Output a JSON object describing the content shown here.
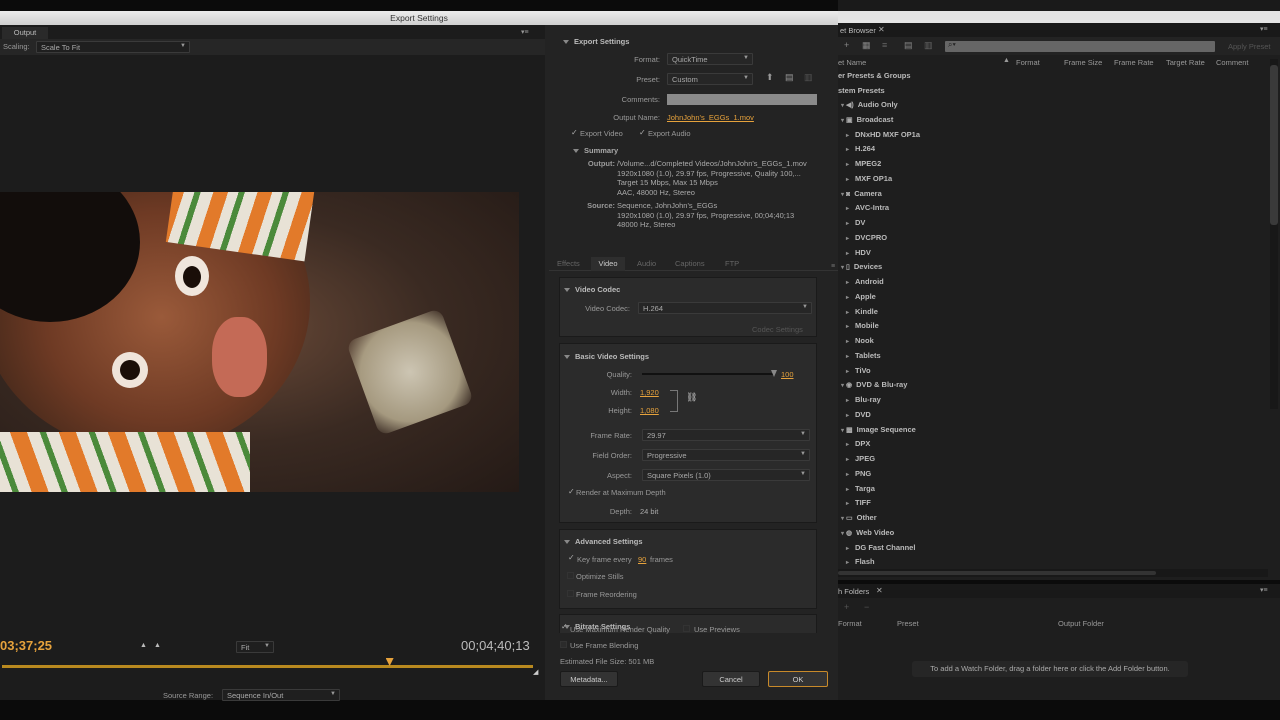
{
  "window": {
    "title": "Export Settings"
  },
  "left": {
    "tab": "Output",
    "scaling_label": "Scaling:",
    "scaling_value": "Scale To Fit",
    "timecode_in": "03;37;25",
    "timecode_out": "00;04;40;13",
    "fit_value": "Fit",
    "source_range_label": "Source Range:",
    "source_range_value": "Sequence In/Out",
    "playhead": 0.73
  },
  "export": {
    "section": "Export Settings",
    "format_label": "Format:",
    "format_value": "QuickTime",
    "preset_label": "Preset:",
    "preset_value": "Custom",
    "comments_label": "Comments:",
    "output_name_label": "Output Name:",
    "output_name": "JohnJohn's_EGGs_1.mov",
    "export_video": "Export Video",
    "export_audio": "Export Audio",
    "summary": "Summary",
    "output_label": "Output:",
    "output_lines": [
      "/Volume...d/Completed Videos/JohnJohn's_EGGs_1.mov",
      "1920x1080 (1.0), 29.97 fps, Progressive, Quality 100,...",
      "Target 15 Mbps, Max 15 Mbps",
      "AAC, 48000 Hz, Stereo"
    ],
    "source_label": "Source:",
    "source_lines": [
      "Sequence, JohnJohn's_EGGs",
      "1920x1080 (1.0), 29.97 fps, Progressive, 00;04;40;13",
      "48000 Hz, Stereo"
    ]
  },
  "tabs": [
    "Effects",
    "Video",
    "Audio",
    "Captions",
    "FTP"
  ],
  "video": {
    "codec_section": "Video Codec",
    "codec_label": "Video Codec:",
    "codec_value": "H.264",
    "codec_settings": "Codec Settings",
    "basic_section": "Basic Video Settings",
    "quality_label": "Quality:",
    "quality_value": "100",
    "quality": 1.0,
    "width_label": "Width:",
    "width_value": "1,920",
    "height_label": "Height:",
    "height_value": "1,080",
    "frame_rate_label": "Frame Rate:",
    "frame_rate_value": "29.97",
    "field_order_label": "Field Order:",
    "field_order_value": "Progressive",
    "aspect_label": "Aspect:",
    "aspect_value": "Square Pixels (1.0)",
    "render_max_depth": "Render at Maximum Depth",
    "depth_label": "Depth:",
    "depth_value": "24 bit",
    "advanced_section": "Advanced Settings",
    "keyframe_every": "Key frame every",
    "keyframe_value": "90",
    "keyframe_unit": "frames",
    "optimize_stills": "Optimize Stills",
    "frame_reordering": "Frame Reordering",
    "bitrate_section": "Bitrate Settings"
  },
  "bottom": {
    "max_render_quality": "Use Maximum Render Quality",
    "use_previews": "Use Previews",
    "frame_blending": "Use Frame Blending",
    "file_size": "Estimated File Size:  501 MB",
    "metadata": "Metadata...",
    "cancel": "Cancel",
    "ok": "OK"
  },
  "browser": {
    "tab": "et Browser",
    "apply_preset": "Apply Preset",
    "columns": [
      "et Name",
      "Format",
      "Frame Size",
      "Frame Rate",
      "Target Rate",
      "Comment"
    ],
    "groups": "er Presets & Groups",
    "system": "stem Presets",
    "items": [
      {
        "label": "Audio Only",
        "indent": 1,
        "icon": "speaker-icon"
      },
      {
        "label": "Broadcast",
        "indent": 1,
        "icon": "tv-icon"
      },
      {
        "label": "DNxHD MXF OP1a",
        "indent": 2,
        "icon": ""
      },
      {
        "label": "H.264",
        "indent": 2,
        "icon": ""
      },
      {
        "label": "MPEG2",
        "indent": 2,
        "icon": ""
      },
      {
        "label": "MXF OP1a",
        "indent": 2,
        "icon": ""
      },
      {
        "label": "Camera",
        "indent": 1,
        "icon": "camera-icon"
      },
      {
        "label": "AVC-Intra",
        "indent": 2,
        "icon": ""
      },
      {
        "label": "DV",
        "indent": 2,
        "icon": ""
      },
      {
        "label": "DVCPRO",
        "indent": 2,
        "icon": ""
      },
      {
        "label": "HDV",
        "indent": 2,
        "icon": ""
      },
      {
        "label": "Devices",
        "indent": 1,
        "icon": "phone-icon"
      },
      {
        "label": "Android",
        "indent": 2,
        "icon": ""
      },
      {
        "label": "Apple",
        "indent": 2,
        "icon": ""
      },
      {
        "label": "Kindle",
        "indent": 2,
        "icon": ""
      },
      {
        "label": "Mobile",
        "indent": 2,
        "icon": ""
      },
      {
        "label": "Nook",
        "indent": 2,
        "icon": ""
      },
      {
        "label": "Tablets",
        "indent": 2,
        "icon": ""
      },
      {
        "label": "TiVo",
        "indent": 2,
        "icon": ""
      },
      {
        "label": "DVD & Blu-ray",
        "indent": 1,
        "icon": "disc-icon"
      },
      {
        "label": "Blu-ray",
        "indent": 2,
        "icon": ""
      },
      {
        "label": "DVD",
        "indent": 2,
        "icon": ""
      },
      {
        "label": "Image Sequence",
        "indent": 1,
        "icon": "image-icon"
      },
      {
        "label": "DPX",
        "indent": 2,
        "icon": ""
      },
      {
        "label": "JPEG",
        "indent": 2,
        "icon": ""
      },
      {
        "label": "PNG",
        "indent": 2,
        "icon": ""
      },
      {
        "label": "Targa",
        "indent": 2,
        "icon": ""
      },
      {
        "label": "TIFF",
        "indent": 2,
        "icon": ""
      },
      {
        "label": "Other",
        "indent": 1,
        "icon": "folder-icon"
      },
      {
        "label": "Web Video",
        "indent": 1,
        "icon": "globe-icon"
      },
      {
        "label": "DG Fast Channel",
        "indent": 2,
        "icon": ""
      },
      {
        "label": "Flash",
        "indent": 2,
        "icon": ""
      }
    ]
  },
  "watch": {
    "tab": "h Folders",
    "columns": [
      "Format",
      "Preset",
      "Output Folder"
    ],
    "hint": "To add a Watch Folder, drag a folder here or click the Add Folder button."
  },
  "colors": {
    "accent": "#e6a23c",
    "panel": "#232323",
    "window": "#1e1e1e"
  }
}
